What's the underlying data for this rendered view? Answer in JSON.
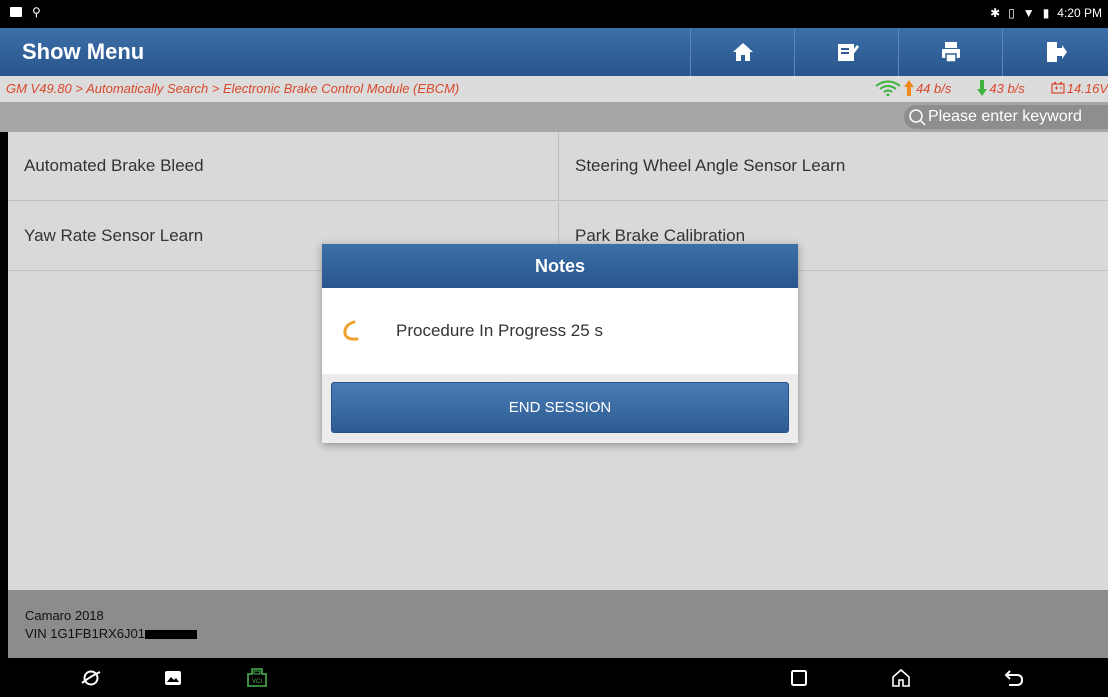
{
  "status_bar": {
    "time": "4:20 PM"
  },
  "header": {
    "title": "Show Menu",
    "buttons": [
      "home-icon",
      "edit-report-icon",
      "print-icon",
      "exit-icon"
    ]
  },
  "breadcrumb": {
    "path": "GM V49.80 > Automatically Search > Electronic Brake Control Module (EBCM)",
    "upload_rate": "44 b/s",
    "download_rate": "43 b/s",
    "battery_voltage": "14.16V"
  },
  "search": {
    "placeholder": "Please enter keyword"
  },
  "menu": {
    "items": [
      {
        "label": "Automated Brake Bleed"
      },
      {
        "label": "Steering Wheel Angle Sensor Learn"
      },
      {
        "label": "Yaw Rate Sensor Learn"
      },
      {
        "label": "Park Brake Calibration"
      }
    ]
  },
  "footer": {
    "vehicle": "Camaro 2018",
    "vin": "VIN 1G1FB1RX6J01"
  },
  "dialog": {
    "title": "Notes",
    "message": "Procedure In Progress  25 s",
    "button": "END SESSION"
  },
  "colors": {
    "header_blue": "#2f5e97",
    "breadcrumb_red": "#d9482b",
    "spinner_orange": "#f0a030",
    "vci_green": "#4caf50"
  }
}
